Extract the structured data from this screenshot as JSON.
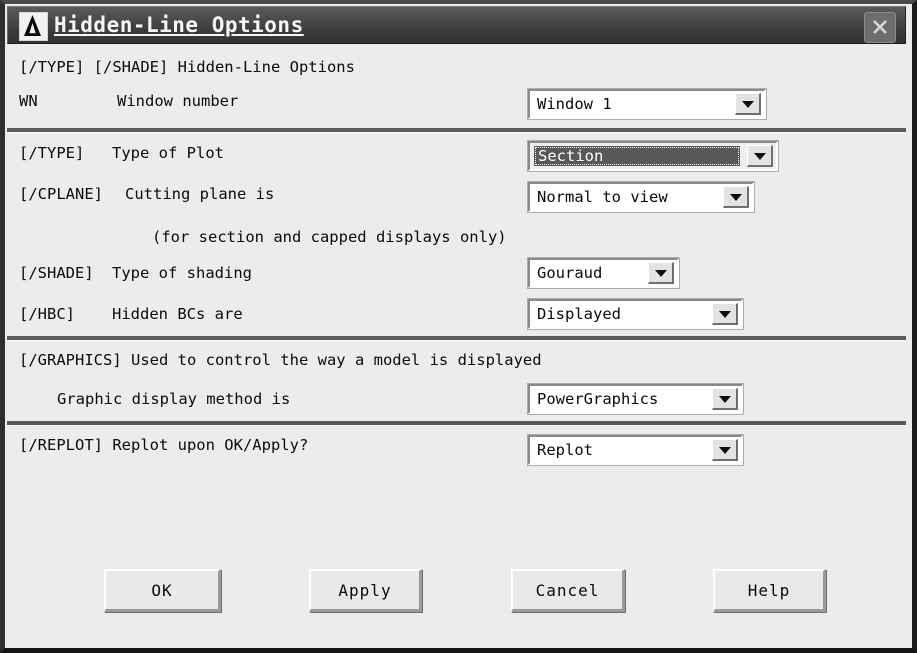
{
  "window": {
    "title": "Hidden-Line Options",
    "icon": "ansys-a-logo-icon",
    "close_label": "close-icon"
  },
  "sections": {
    "window_number": {
      "heading": "[/TYPE] [/SHADE]  Hidden-Line Options",
      "tag": "WN",
      "label": "Window number",
      "value": "Window 1"
    },
    "plot": {
      "type_tag": "[/TYPE]",
      "type_label": "Type of Plot",
      "type_value": "Section",
      "cplane_tag": "[/CPLANE]",
      "cplane_label": "Cutting plane is",
      "cplane_value": "Normal to view",
      "cplane_note": "(for section and capped displays only)",
      "shade_tag": "[/SHADE]",
      "shade_label": "Type of shading",
      "shade_value": "Gouraud",
      "hbc_tag": "[/HBC]",
      "hbc_label": "Hidden BCs are",
      "hbc_value": "Displayed"
    },
    "graphics": {
      "heading": "[/GRAPHICS]  Used to control the way a model is displayed",
      "label": "Graphic display method is",
      "value": "PowerGraphics"
    },
    "replot": {
      "label": "[/REPLOT] Replot upon OK/Apply?",
      "value": "Replot"
    }
  },
  "buttons": {
    "ok": "OK",
    "apply": "Apply",
    "cancel": "Cancel",
    "help": "Help"
  },
  "colors": {
    "dialog_bg": "#ececec",
    "titlebar": "#4a4a4a",
    "divider": "#5a5a5a",
    "selection_bg": "#585858",
    "selection_fg": "#ffffff",
    "text": "#0b0b0b"
  }
}
